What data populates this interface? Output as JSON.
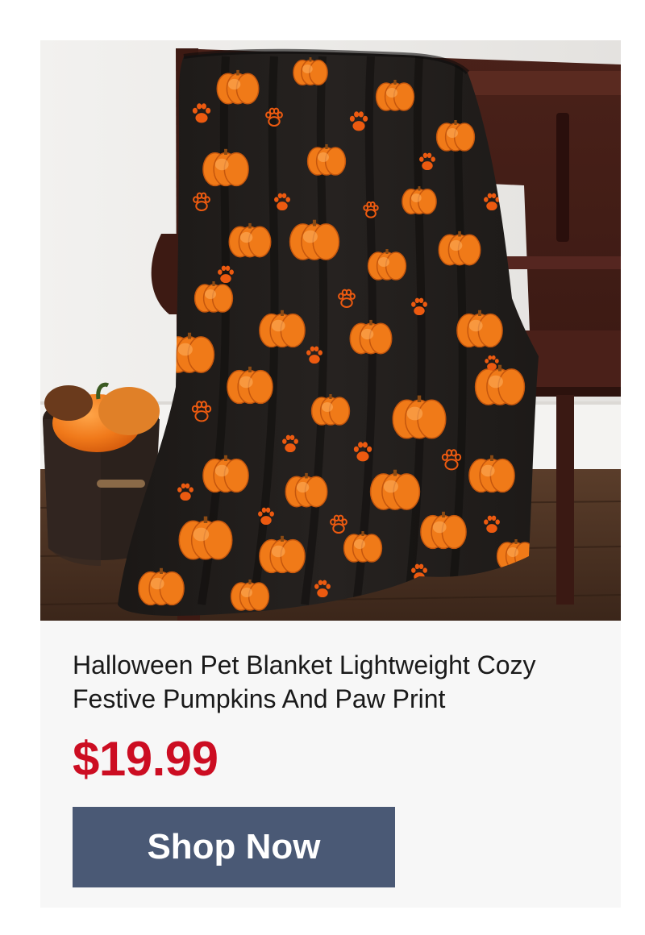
{
  "product": {
    "image_alt": "Halloween pet blanket with pumpkins and paw prints draped over a wooden bench",
    "title": "Halloween Pet Blanket Lightweight Cozy Festive Pumpkins And Paw Print",
    "price": "$19.99",
    "cta_label": "Shop Now"
  },
  "colors": {
    "price": "#cc0d22",
    "button": "#4a5975",
    "card_background": "#f7f7f7",
    "blanket_base": "#1e1a18",
    "pumpkin": "#f07a18",
    "paw": "#ec5a10"
  }
}
